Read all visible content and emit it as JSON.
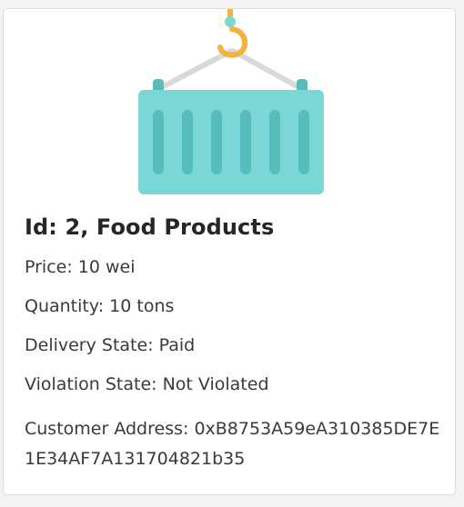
{
  "card": {
    "title": "Id: 2, Food Products",
    "price": "Price: 10 wei",
    "quantity": "Quantity: 10 tons",
    "delivery_state": "Delivery State: Paid",
    "violation_state": "Violation State: Not Violated",
    "customer_address": "Customer Address: 0xB8753A59eA310385DE7E1E34AF7A131704821b35"
  },
  "icons": {
    "illustration": "shipping-container-crane-hook-icon"
  },
  "colors": {
    "container": "#7bd7d6",
    "container_ribs": "#56bdbd",
    "hook": "#f4b23c",
    "cables": "#d9d9d9",
    "page_bg": "#f1f3f4",
    "card_bg": "#ffffff"
  }
}
